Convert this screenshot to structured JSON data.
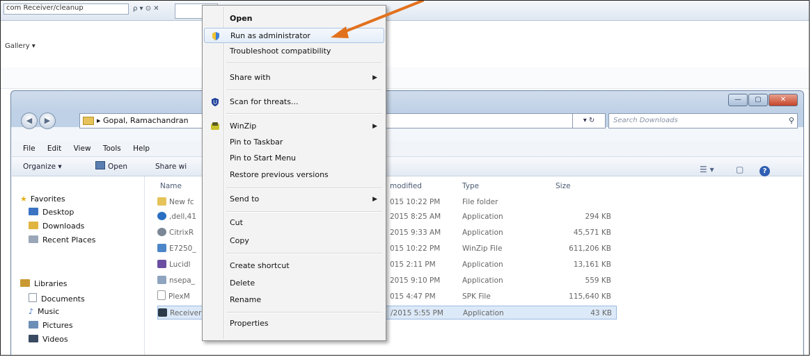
{
  "background": {
    "address_text": "com Receiver/cleanup",
    "address_icons": "ρ ▾ ⊙ ✕",
    "gallery_label": "Gallery ▾"
  },
  "window": {
    "caption_buttons": [
      "—",
      "▢",
      "✕"
    ],
    "address_path": "▸ Gopal, Ramachandran",
    "address_controls": "▾ ↻",
    "search_placeholder": "Search Downloads",
    "menubar": [
      "File",
      "Edit",
      "View",
      "Tools",
      "Help"
    ],
    "toolbar": {
      "organize": "Organize ▾",
      "open": "Open",
      "share": "Share wi",
      "right_icons": [
        "☰ ▾",
        "▢"
      ],
      "help": "?"
    },
    "navpane": {
      "favorites": "Favorites",
      "favorites_items": [
        "Desktop",
        "Downloads",
        "Recent Places"
      ],
      "libraries": "Libraries",
      "libraries_items": [
        "Documents",
        "Music",
        "Pictures",
        "Videos"
      ]
    },
    "columns": {
      "name": "Name",
      "modified": "modified",
      "type": "Type",
      "size": "Size"
    },
    "files": [
      {
        "name": "New fc",
        "modified": "015 10:22 PM",
        "type": "File folder",
        "size": ""
      },
      {
        "name": ",dell,41",
        "modified": "2015 8:25 AM",
        "type": "Application",
        "size": "294 KB"
      },
      {
        "name": "CitrixR",
        "modified": "2015 9:33 AM",
        "type": "Application",
        "size": "45,571 KB"
      },
      {
        "name": "E7250_",
        "modified": "015 10:22 PM",
        "type": "WinZip File",
        "size": "611,206 KB"
      },
      {
        "name": "Lucidl",
        "modified": "015 2:11 PM",
        "type": "Application",
        "size": "13,161 KB"
      },
      {
        "name": "nsepa_",
        "modified": "2015 9:10 PM",
        "type": "Application",
        "size": "559 KB"
      },
      {
        "name": "PlexM",
        "modified": "015 4:47 PM",
        "type": "SPK File",
        "size": "115,640 KB"
      },
      {
        "name": "ReceiverCleanupUtil",
        "modified": "/2015 5:55 PM",
        "type": "Application",
        "size": "43 KB"
      }
    ]
  },
  "context_menu": {
    "items": [
      {
        "label": "Open",
        "bold": true
      },
      {
        "label": "Run as administrator",
        "highlighted": true,
        "icon": "uac-shield-icon"
      },
      {
        "label": "Troubleshoot compatibility"
      },
      {
        "label": "Share with",
        "submenu": true
      },
      {
        "label": "Scan for threats...",
        "icon": "antivirus-shield-icon"
      },
      {
        "label": "WinZip",
        "submenu": true,
        "icon": "winzip-icon"
      },
      {
        "label": "Pin to Taskbar"
      },
      {
        "label": "Pin to Start Menu"
      },
      {
        "label": "Restore previous versions"
      },
      {
        "label": "Send to",
        "submenu": true
      },
      {
        "label": "Cut"
      },
      {
        "label": "Copy"
      },
      {
        "label": "Create shortcut"
      },
      {
        "label": "Delete"
      },
      {
        "label": "Rename"
      },
      {
        "label": "Properties"
      }
    ],
    "submenu_arrow": "▶"
  },
  "annotation": {
    "arrow_color": "#e2711d"
  }
}
